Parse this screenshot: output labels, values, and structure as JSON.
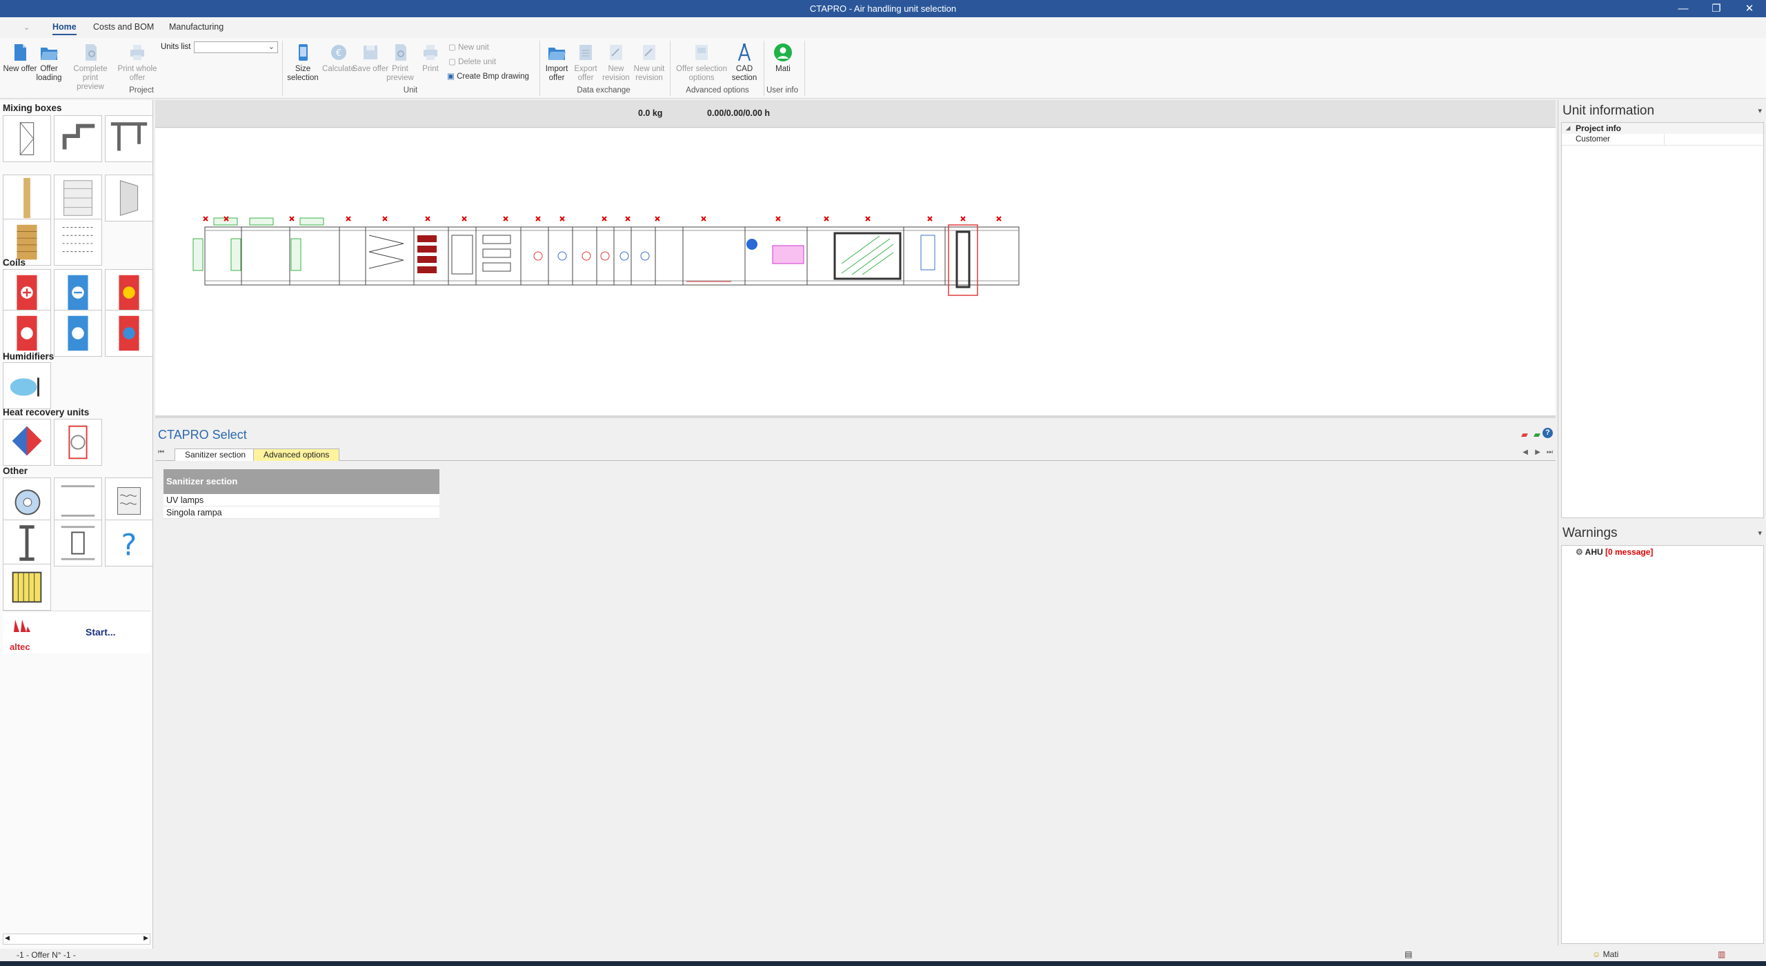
{
  "window": {
    "title": "CTAPRO - Air handling unit selection",
    "minimize": "—",
    "restore": "❐",
    "close": "✕"
  },
  "ribbon_tabs": [
    {
      "label": "Home"
    },
    {
      "label": "Costs and BOM"
    },
    {
      "label": "Manufacturing"
    }
  ],
  "quick_access": "⌄",
  "ribbon": {
    "project": {
      "label": "Project",
      "new_offer": "New offer",
      "offer_loading": "Offer loading",
      "complete_print_preview": "Complete print preview",
      "print_whole_offer": "Print whole offer",
      "units_list_label": "Units list"
    },
    "unit": {
      "label": "Unit",
      "size_selection": "Size selection",
      "calculate": "Calculate",
      "save_offer": "Save offer",
      "print_preview": "Print preview",
      "print": "Print",
      "new_unit": "New unit",
      "delete_unit": "Delete unit",
      "create_bmp": "Create Bmp drawing"
    },
    "data_exchange": {
      "label": "Data exchange",
      "import_offer": "Import offer",
      "export_offer": "Export offer",
      "new_revision": "New revision",
      "new_unit_revision": "New unit revision"
    },
    "advanced": {
      "label": "Advanced options",
      "offer_selection_options": "Offer selection options",
      "cad_section": "CAD section"
    },
    "user": {
      "label": "User info",
      "name": "Mati"
    }
  },
  "left": {
    "categories": [
      "Mixing boxes",
      "Coils",
      "Humidifiers",
      "Heat recovery units",
      "Other"
    ],
    "start": "Start...",
    "brand": "altec"
  },
  "center": {
    "weight": "0.0 kg",
    "hours": "0.00/0.00/0.00 h"
  },
  "select": {
    "title": "CTAPRO Select",
    "tabs": [
      {
        "label": "Sanitizer section"
      },
      {
        "label": "Advanced options"
      }
    ],
    "grid_header": "Sanitizer section",
    "rows": [
      "UV lamps",
      "Singola rampa"
    ]
  },
  "unit_info": {
    "title": "Unit information",
    "group": "Project info",
    "field": "Customer"
  },
  "warnings": {
    "title": "Warnings",
    "node": "AHU",
    "message": "[0 message]"
  },
  "status": {
    "left": "-1 - Offer N° -1 -",
    "user": "Mati"
  },
  "colors": {
    "title_bar": "#2b579a",
    "accent": "#2b68b0",
    "error": "#e00000"
  }
}
